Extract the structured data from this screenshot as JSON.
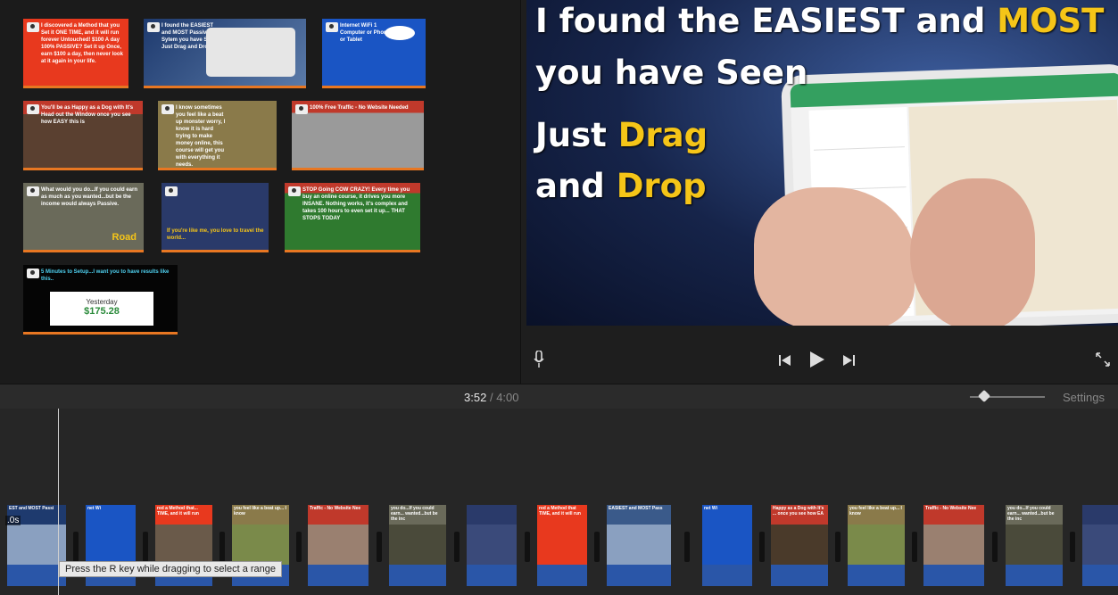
{
  "browser": {
    "thumbs": [
      {
        "text": "I discovered a Method that you Set it ONE TIME, and it will run forever Untouched! $100 A day 100% PASSIVE? Set it up Once, earn $100 a day, then never look at it again in your life.",
        "bg": "#e8391e"
      },
      {
        "text": "I found the EASIEST and MOST Passive Sytem you have Seen Just Drag and Drop",
        "bg": "#3a5a8a"
      },
      {
        "text": "Internet WiFi 1 Computer or Phone or Tablet",
        "bg": "#1a55c4"
      },
      {
        "text": "You'll be as Happy as a Dog with It's Head out the Window once you see how EASY this is",
        "bg": "#5a4030"
      },
      {
        "text": "I know sometimes you feel like a beat up monster worry, I know it is hard trying to make money online, this course will get you with everything it needs.",
        "bg": "#8a7a4a"
      },
      {
        "text": "100% Free Traffic - No Website Needed",
        "bg": "#c0392b"
      },
      {
        "text": "What would you do...If you could earn as much as you wanted...but be the income would always Passive.",
        "bg": "#6a6a5a"
      },
      {
        "text": "If you're like me, you love to travel the world...",
        "bg": "#2a3a6a"
      },
      {
        "text": "STOP Going COW CRAZY! Every time you buy an online course, it drives you more INSANE. Nothing works, it's complex and takes 100 hours to even set it up... THAT STOPS TODAY",
        "bg": "#2f7a2f"
      },
      {
        "text": "5 Minutes to Setup...I want you to have results like this..",
        "bg": "#050505"
      }
    ],
    "earnings_label": "Yesterday",
    "earnings_value": "$175.28",
    "road_label": "Road"
  },
  "viewer": {
    "line1_white": "I found the EASIEST and ",
    "line1_yellow": "MOST Passiv",
    "line2": "you have Seen",
    "line3_white": "Just ",
    "line3_yellow": "Drag",
    "line4_white": "and ",
    "line4_yellow": "Drop"
  },
  "controls": {
    "mic_icon": "microphone-icon",
    "prev_icon": "skip-back-icon",
    "play_icon": "play-icon",
    "next_icon": "skip-forward-icon",
    "fullscreen_icon": "fullscreen-icon"
  },
  "timecode": {
    "current": "3:52",
    "separator": "/",
    "total": "4:00",
    "settings_label": "Settings",
    "zoom_level": 0.5
  },
  "timeline": {
    "first_clip_duration": ".0s",
    "clips": [
      {
        "top": "EST and MOST Passi",
        "tc": "#1e3a6e",
        "bc": "#8aa0c0"
      },
      {
        "top": "net  Wi",
        "tc": "#1a55c4",
        "bc": "#1a55c4"
      },
      {
        "top": "red a Method that... TIME, and it will run",
        "tc": "#e8391e",
        "bc": "#6a5a4a"
      },
      {
        "top": "you feel like a beat up... I know",
        "tc": "#8a7a4a",
        "bc": "#7a8a4a"
      },
      {
        "top": "Traffic - No Website Nee",
        "tc": "#c0392b",
        "bc": "#9a8070"
      },
      {
        "top": "you do...If you could earn... wanted...but be the inc",
        "tc": "#6a6a5a",
        "bc": "#4a4a3a"
      },
      {
        "top": "",
        "tc": "#2a3a6a",
        "bc": "#3a4a7a"
      },
      {
        "top": "red a Method that TIME, and it will run",
        "tc": "#e8391e",
        "bc": "#e8391e"
      },
      {
        "top": "EASIEST and MOST Pass",
        "tc": "#3a5a8a",
        "bc": "#8aa0c0"
      },
      {
        "top": "net  Wi",
        "tc": "#1a55c4",
        "bc": "#1a55c4"
      },
      {
        "top": "Happy as a Dog with It's ... once you see how EA",
        "tc": "#c0392b",
        "bc": "#4a3a2a"
      },
      {
        "top": "you feel like a beat up... I know",
        "tc": "#8a7a4a",
        "bc": "#7a8a4a"
      },
      {
        "top": "Traffic - No Website Nee",
        "tc": "#c0392b",
        "bc": "#9a8070"
      },
      {
        "top": "you do...If you could earn... wanted...but be the inc",
        "tc": "#6a6a5a",
        "bc": "#4a4a3a"
      },
      {
        "top": "",
        "tc": "#2a3a6a",
        "bc": "#3a4a7a"
      }
    ],
    "tooltip": "Press the R key while dragging to select a range"
  }
}
